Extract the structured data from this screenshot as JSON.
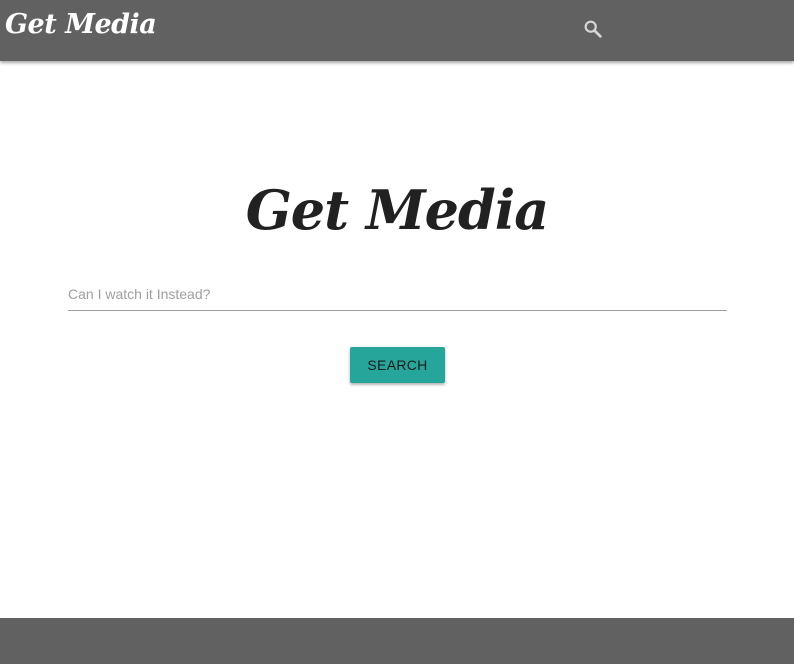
{
  "navbar": {
    "brand": "Get Media",
    "search_icon": "search-icon",
    "background_color": "#616161"
  },
  "main": {
    "title": "Get Media",
    "search": {
      "placeholder": "Can I watch it Instead?",
      "value": ""
    },
    "search_button_label": "SEARCH",
    "button_color": "#26a69a"
  },
  "footer": {
    "background_color": "#616161"
  }
}
